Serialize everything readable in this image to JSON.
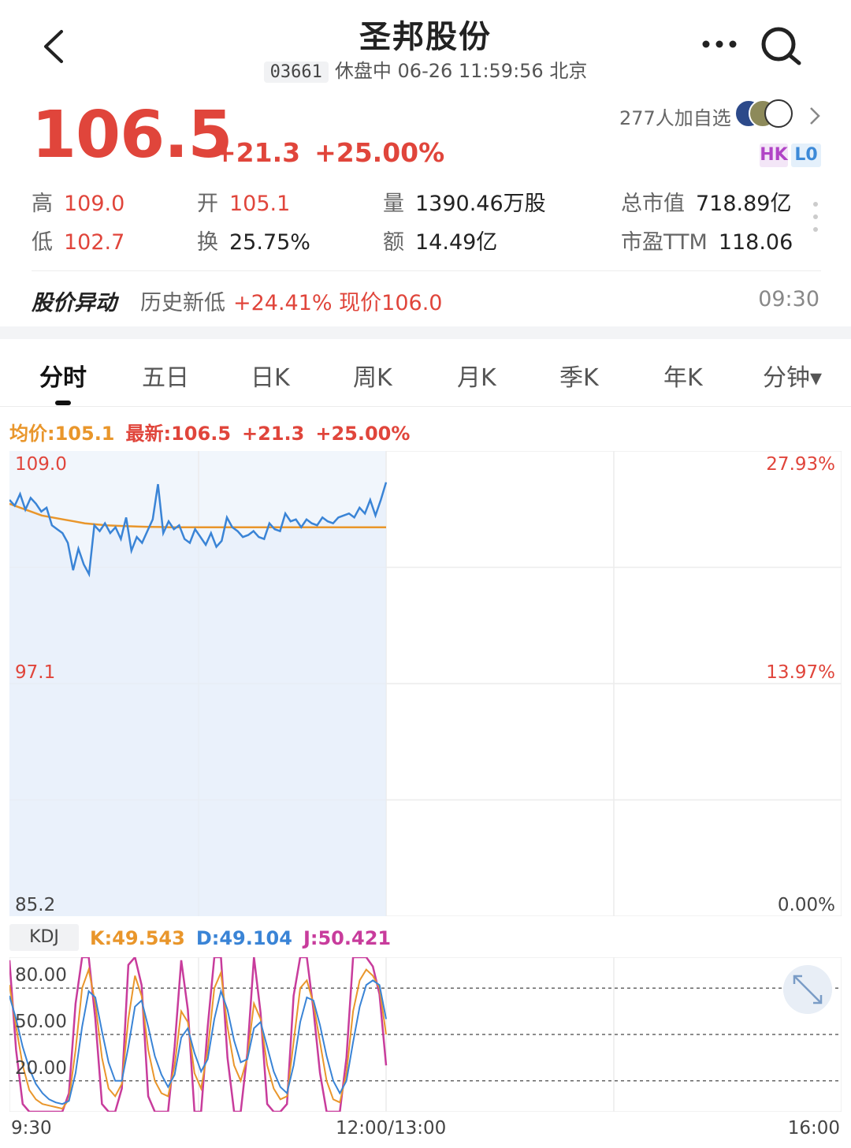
{
  "header": {
    "title": "圣邦股份",
    "code": "03661",
    "status_text": "休盘中 06-26 11:59:56 北京"
  },
  "quote": {
    "price": "106.5",
    "change": "+21.3",
    "change_pct": "+25.00%",
    "watchers": "277人加自选",
    "tag_hk": "HK",
    "tag_level": "L0"
  },
  "stats": {
    "high_label": "高",
    "high": "109.0",
    "low_label": "低",
    "low": "102.7",
    "open_label": "开",
    "open": "105.1",
    "turnover_label": "换",
    "turnover": "25.75%",
    "volume_label": "量",
    "volume": "1390.46万股",
    "amount_label": "额",
    "amount": "14.49亿",
    "mcap_label": "总市值",
    "mcap": "718.89亿",
    "pe_label": "市盈TTM",
    "pe": "118.06"
  },
  "alert": {
    "title": "股价异动",
    "text": "历史新低",
    "change": "+24.41% 现价106.0",
    "time": "09:30"
  },
  "tabs": [
    {
      "label": "分时",
      "active": true
    },
    {
      "label": "五日"
    },
    {
      "label": "日K"
    },
    {
      "label": "周K"
    },
    {
      "label": "月K"
    },
    {
      "label": "季K"
    },
    {
      "label": "年K"
    },
    {
      "label": "分钟▾"
    }
  ],
  "legend": {
    "avg": "均价:105.1",
    "latest": "最新:106.5",
    "change": "+21.3",
    "change_pct": "+25.00%"
  },
  "colors": {
    "red": "#e0453b",
    "price_line": "#3a84d6",
    "avg_line": "#e9962b",
    "k_line": "#e9962b",
    "d_line": "#3a84d6",
    "j_line": "#c83c9c"
  },
  "chart_data": [
    {
      "type": "line",
      "y_labels_left": [
        "109.0",
        "97.1",
        "85.2"
      ],
      "y_labels_right": [
        "27.93%",
        "13.97%",
        "0.00%"
      ],
      "ylim": [
        85.2,
        109.0
      ],
      "series": [
        {
          "values": [
            106.5,
            106.2,
            106.8,
            106.0,
            106.6,
            106.3,
            105.9,
            106.1,
            105.2,
            105.0,
            104.8,
            104.3,
            102.9,
            104.0,
            103.2,
            102.7,
            105.2,
            104.9,
            105.3,
            104.8,
            105.1,
            104.5,
            105.6,
            103.9,
            104.6,
            104.3,
            104.9,
            105.5,
            107.3,
            104.8,
            105.4,
            105.0,
            105.2,
            104.5,
            104.3,
            105.0,
            104.6,
            104.2,
            104.8,
            104.1,
            104.4,
            105.6,
            105.1,
            104.9,
            104.6,
            104.7,
            104.9,
            104.6,
            104.5,
            105.3,
            105.0,
            104.9,
            105.8,
            105.4,
            105.5,
            105.1,
            105.5,
            105.3,
            105.2,
            105.6,
            105.4,
            105.3,
            105.6,
            105.7,
            105.8,
            105.6,
            106.1,
            105.8,
            106.5,
            105.7,
            106.5,
            107.4
          ]
        },
        {
          "values": [
            106.3,
            106.1,
            105.9,
            105.7,
            105.6,
            105.5,
            105.4,
            105.3,
            105.25,
            105.2,
            105.17,
            105.15,
            105.13,
            105.12,
            105.11,
            105.1,
            105.1,
            105.1,
            105.1,
            105.1,
            105.1,
            105.1,
            105.1,
            105.1,
            105.1,
            105.1,
            105.1,
            105.1,
            105.1,
            105.1,
            105.1,
            105.1,
            105.1,
            105.1,
            105.1,
            105.1
          ]
        }
      ]
    },
    {
      "type": "line",
      "y_labels": [
        "80.00",
        "50.00",
        "20.00"
      ],
      "ylim": [
        0,
        100
      ],
      "gridlines": [
        80,
        50,
        20
      ],
      "x_labels": [
        "9:30",
        "12:00/13:00",
        "16:00"
      ],
      "series": [
        {
          "name": "K",
          "values": [
            82,
            55,
            30,
            14,
            8,
            5,
            4,
            3,
            2,
            8,
            40,
            80,
            92,
            70,
            35,
            15,
            10,
            18,
            60,
            88,
            75,
            40,
            20,
            12,
            10,
            30,
            65,
            58,
            25,
            15,
            40,
            80,
            90,
            55,
            30,
            20,
            35,
            70,
            60,
            30,
            15,
            8,
            10,
            45,
            80,
            85,
            70,
            45,
            20,
            8,
            6,
            25,
            65,
            85,
            92,
            88,
            80,
            50
          ]
        },
        {
          "name": "D",
          "values": [
            75,
            60,
            42,
            28,
            18,
            12,
            8,
            6,
            5,
            7,
            25,
            55,
            78,
            74,
            52,
            32,
            20,
            20,
            42,
            68,
            72,
            55,
            36,
            24,
            16,
            24,
            48,
            54,
            38,
            26,
            34,
            60,
            78,
            66,
            46,
            32,
            34,
            54,
            58,
            42,
            26,
            16,
            12,
            30,
            58,
            74,
            72,
            56,
            36,
            20,
            12,
            20,
            45,
            68,
            82,
            85,
            82,
            60
          ]
        },
        {
          "name": "J",
          "values": [
            98,
            40,
            5,
            0,
            0,
            0,
            0,
            0,
            0,
            12,
            70,
            100,
            100,
            60,
            5,
            0,
            0,
            15,
            95,
            100,
            82,
            10,
            0,
            0,
            0,
            42,
            98,
            66,
            0,
            0,
            55,
            100,
            100,
            35,
            0,
            0,
            38,
            100,
            64,
            5,
            0,
            0,
            5,
            75,
            100,
            100,
            66,
            25,
            0,
            0,
            0,
            35,
            100,
            100,
            100,
            94,
            76,
            30
          ]
        }
      ],
      "legend": {
        "badge": "KDJ",
        "k": "K:49.543",
        "d": "D:49.104",
        "j": "J:50.421"
      }
    }
  ]
}
